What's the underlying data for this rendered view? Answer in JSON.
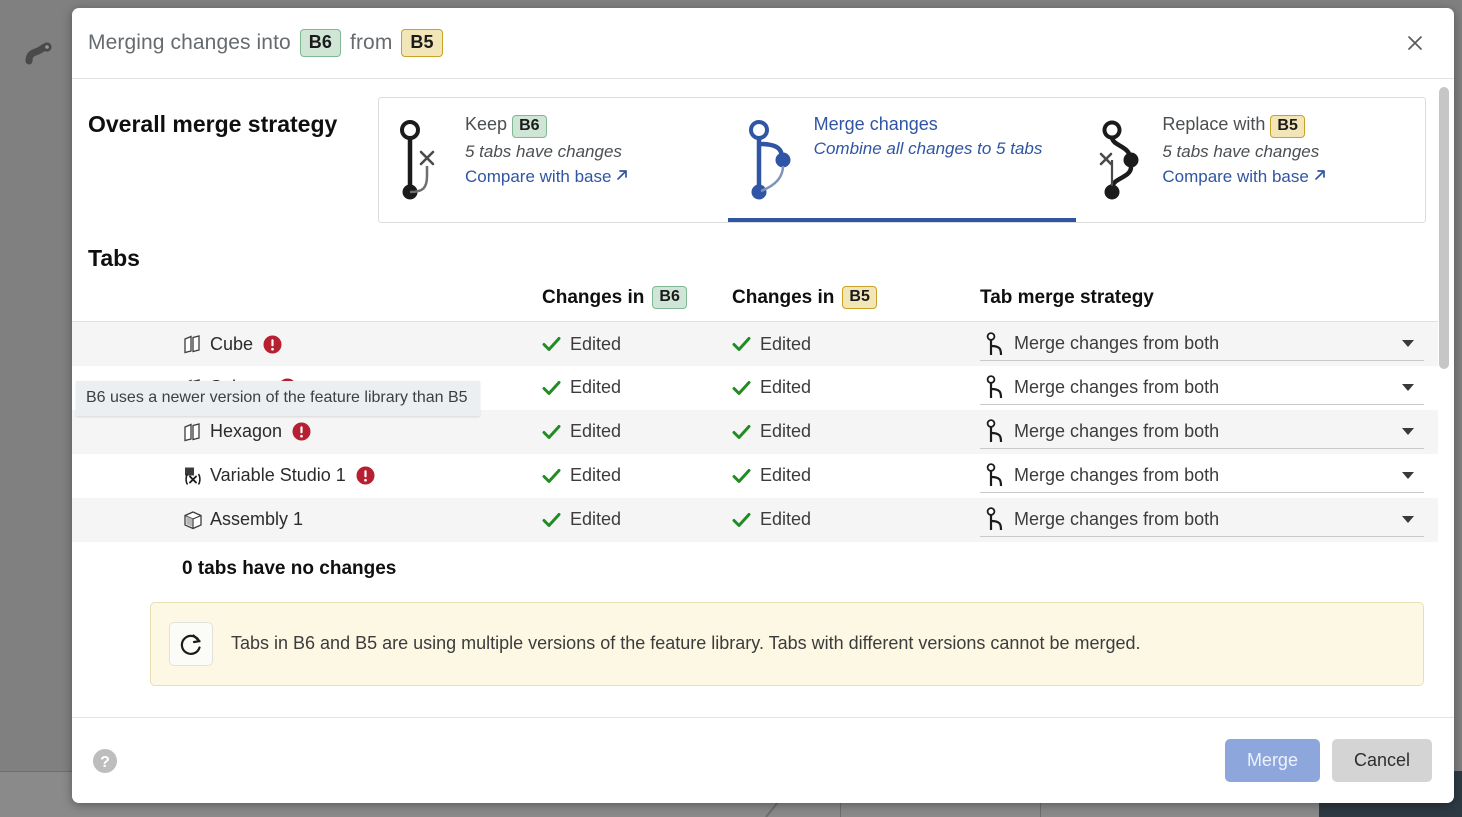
{
  "backdrop": {
    "branch_icon": "branch-icon"
  },
  "dialog": {
    "title_prefix": "Merging changes into",
    "title_target_branch": "B6",
    "title_middle": "from",
    "title_source_branch": "B5",
    "close_icon": "close-icon"
  },
  "overall": {
    "label": "Overall merge strategy",
    "cards": [
      {
        "graphic": "keep-branch-graphic",
        "title_prefix": "Keep",
        "badge": "B6",
        "badge_style": "green",
        "subtitle": "5 tabs have changes",
        "link": "Compare with base",
        "link_icon": "external-link-icon",
        "selected": false
      },
      {
        "graphic": "merge-branch-graphic",
        "title_prefix": "Merge changes",
        "badge": "",
        "badge_style": "none",
        "subtitle": "Combine all changes to 5 tabs",
        "link": "",
        "link_icon": "",
        "selected": true
      },
      {
        "graphic": "replace-branch-graphic",
        "title_prefix": "Replace with",
        "badge": "B5",
        "badge_style": "yellow",
        "subtitle": "5 tabs have changes",
        "link": "Compare with base",
        "link_icon": "external-link-icon",
        "selected": false
      }
    ]
  },
  "tabs_section": {
    "heading": "Tabs",
    "columns": {
      "name": "",
      "changes_a_prefix": "Changes in",
      "changes_a_badge": "B6",
      "changes_b_prefix": "Changes in",
      "changes_b_badge": "B5",
      "strategy": "Tab merge strategy"
    },
    "rows": [
      {
        "name": "Cube",
        "icon": "part-studio-icon",
        "warning": "warning-icon",
        "changes_a": "Edited",
        "changes_b": "Edited",
        "strategy": "Merge changes from both"
      },
      {
        "name": "Sphere",
        "icon": "part-studio-icon",
        "warning": "warning-icon",
        "changes_a": "Edited",
        "changes_b": "Edited",
        "strategy": "Merge changes from both"
      },
      {
        "name": "Hexagon",
        "icon": "part-studio-icon",
        "warning": "warning-icon",
        "changes_a": "Edited",
        "changes_b": "Edited",
        "strategy": "Merge changes from both"
      },
      {
        "name": "Variable Studio 1",
        "icon": "variable-studio-icon",
        "warning": "warning-icon",
        "changes_a": "Edited",
        "changes_b": "Edited",
        "strategy": "Merge changes from both"
      },
      {
        "name": "Assembly 1",
        "icon": "assembly-icon",
        "warning": "",
        "changes_a": "Edited",
        "changes_b": "Edited",
        "strategy": "Merge changes from both"
      }
    ],
    "no_changes_summary": "0 tabs have no changes"
  },
  "warning_banner": {
    "icon": "feature-library-update-icon",
    "text": "Tabs in B6 and B5 are using multiple versions of the feature library. Tabs with different versions cannot be merged."
  },
  "tooltip": {
    "text": "B6 uses a newer version of the feature library than B5"
  },
  "footer": {
    "help_icon": "help-icon",
    "merge_label": "Merge",
    "cancel_label": "Cancel"
  },
  "colors": {
    "accent_blue": "#2f55a4",
    "merge_button": "#8da7dd",
    "cancel_button": "#d4d4d4",
    "badge_green_bg": "#cfe6d6",
    "badge_yellow_bg": "#f2e6b8",
    "warning_banner_bg": "#fdf8e3",
    "check_green": "#228b22",
    "warning_red": "#b52033"
  }
}
